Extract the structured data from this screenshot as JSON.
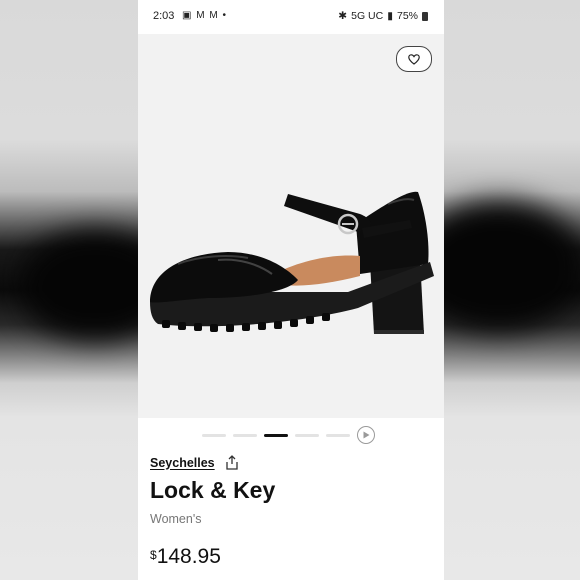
{
  "status_bar": {
    "time": "2:03",
    "notification_icons": "▣ M M •",
    "network": "5G UC",
    "battery": "75%"
  },
  "product": {
    "brand": "Seychelles",
    "name": "Lock & Key",
    "category": "Women's",
    "price_currency": "$",
    "price_value": "148.95",
    "image_index": 3,
    "image_count": 5
  },
  "icons": {
    "wishlist": "heart-icon",
    "share": "share-icon",
    "video": "play-icon"
  },
  "colors": {
    "text_primary": "#111111",
    "text_secondary": "#777777",
    "dot_active": "#111111",
    "dot_inactive": "#e3e3e3"
  }
}
